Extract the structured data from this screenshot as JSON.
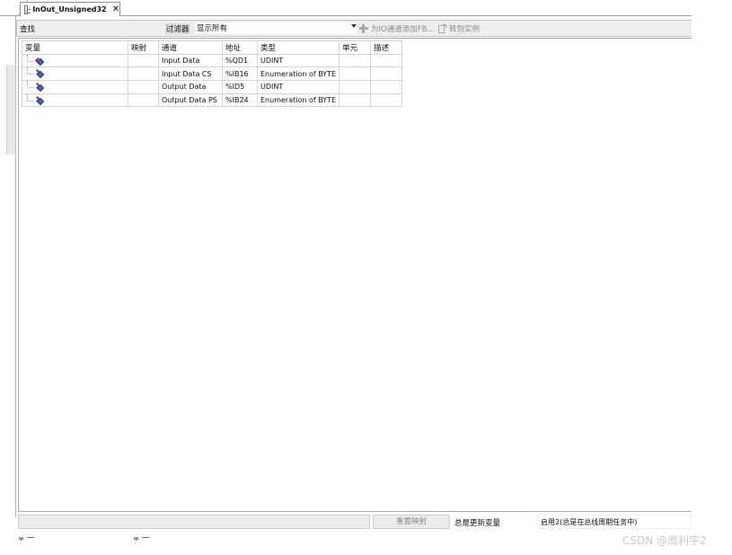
{
  "tab": {
    "title": "InOut_Unsigned32"
  },
  "toolbar": {
    "find_label": "查找",
    "filter_label": "过滤器",
    "filter_value": "显示所有",
    "add_fb_label": "为IO通道添加FB...",
    "goto_label": "转到实例"
  },
  "table": {
    "headers": [
      "变量",
      "映射",
      "通道",
      "地址",
      "类型",
      "单元",
      "描述"
    ],
    "rows": [
      {
        "icon": "output-variable-icon",
        "variable": "",
        "mapping": "",
        "channel": "Input Data",
        "address": "%QD1",
        "type": "UDINT",
        "unit": "",
        "description": ""
      },
      {
        "icon": "input-variable-icon",
        "variable": "",
        "mapping": "",
        "channel": "Input Data CS",
        "address": "%IB16",
        "type": "Enumeration of BYTE",
        "unit": "",
        "description": ""
      },
      {
        "icon": "input-variable-icon",
        "variable": "",
        "mapping": "",
        "channel": "Output Data",
        "address": "%ID5",
        "type": "UDINT",
        "unit": "",
        "description": ""
      },
      {
        "icon": "input-variable-icon",
        "variable": "",
        "mapping": "",
        "channel": "Output Data PS",
        "address": "%IB24",
        "type": "Enumeration of BYTE",
        "unit": "",
        "description": ""
      }
    ]
  },
  "status": {
    "reset_mapping_label": "重置映射",
    "always_update_label": "总是更新变量",
    "always_update_value": "启用2(总是在总线周期任务中)"
  },
  "watermark": "CSDN @周利宇2"
}
